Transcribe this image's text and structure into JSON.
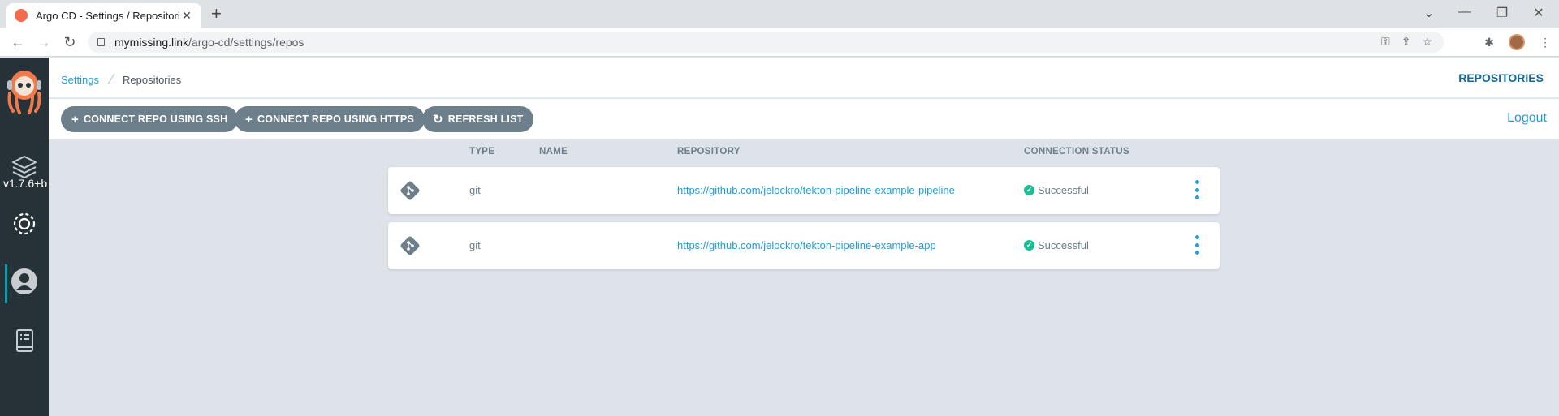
{
  "browser": {
    "tab_title": "Argo CD - Settings / Repositories",
    "url_host": "mymissing.link",
    "url_path": "/argo-cd/settings/repos"
  },
  "sidebar": {
    "version": "v1.7.6+b",
    "items": [
      {
        "name": "applications",
        "icon": "layers-icon"
      },
      {
        "name": "settings",
        "icon": "gear-icon",
        "active": true
      },
      {
        "name": "user-info",
        "icon": "user-icon"
      },
      {
        "name": "docs",
        "icon": "docs-icon"
      }
    ]
  },
  "breadcrumb": {
    "parent": "Settings",
    "current": "Repositories"
  },
  "page_title": "REPOSITORIES",
  "toolbar": {
    "connect_ssh": "CONNECT REPO USING SSH",
    "connect_https": "CONNECT REPO USING HTTPS",
    "refresh": "REFRESH LIST",
    "logout": "Logout"
  },
  "table": {
    "headers": {
      "type": "TYPE",
      "name": "NAME",
      "repository": "REPOSITORY",
      "status": "CONNECTION STATUS"
    },
    "rows": [
      {
        "type": "git",
        "name": "",
        "repository": "https://github.com/jelockro/tekton-pipeline-example-pipeline",
        "status": "Successful"
      },
      {
        "type": "git",
        "name": "",
        "repository": "https://github.com/jelockro/tekton-pipeline-example-app",
        "status": "Successful"
      }
    ]
  },
  "colors": {
    "accent": "#279ad3",
    "button": "#6d7f8b",
    "success": "#18be94",
    "sidebar": "#263238"
  }
}
